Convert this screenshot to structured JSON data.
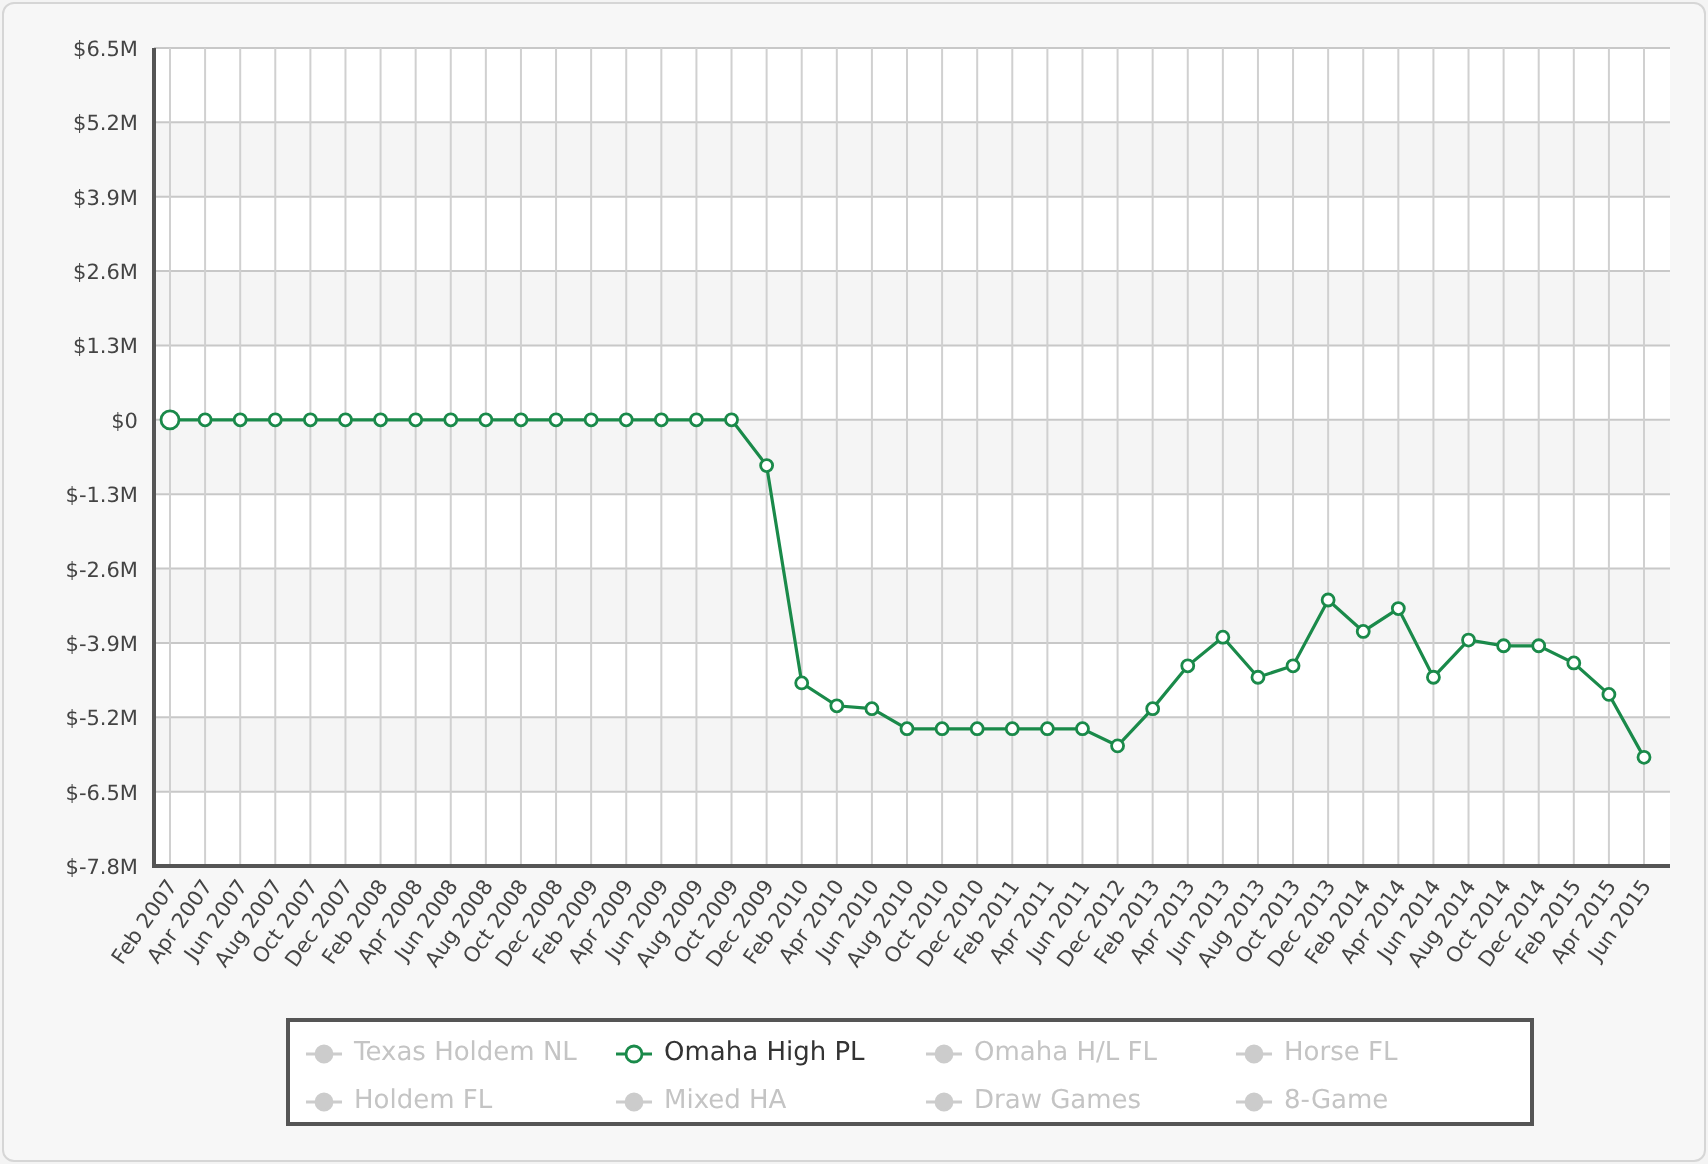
{
  "chart": {
    "chart_data": {
      "type": "line",
      "grid": true,
      "categories": [
        "Feb 2007",
        "Apr 2007",
        "Jun 2007",
        "Aug 2007",
        "Oct 2007",
        "Dec 2007",
        "Feb 2008",
        "Apr 2008",
        "Jun 2008",
        "Aug 2008",
        "Oct 2008",
        "Dec 2008",
        "Feb 2009",
        "Apr 2009",
        "Jun 2009",
        "Aug 2009",
        "Oct 2009",
        "Dec 2009",
        "Feb 2010",
        "Apr 2010",
        "Jun 2010",
        "Aug 2010",
        "Oct 2010",
        "Dec 2010",
        "Feb 2011",
        "Apr 2011",
        "Jun 2011",
        "Dec 2012",
        "Feb 2013",
        "Apr 2013",
        "Jun 2013",
        "Aug 2013",
        "Oct 2013",
        "Dec 2013",
        "Feb 2014",
        "Apr 2014",
        "Jun 2014",
        "Aug 2014",
        "Oct 2014",
        "Dec 2014",
        "Feb 2015",
        "Apr 2015",
        "Jun 2015"
      ],
      "series": [
        {
          "name": "Omaha High PL",
          "color": "#1a8a4a",
          "marker": "circle",
          "values": [
            0,
            0,
            0,
            0,
            0,
            0,
            0,
            0,
            0,
            0,
            0,
            0,
            0,
            0,
            0,
            0,
            0,
            -0.8,
            -4.6,
            -5.0,
            -5.05,
            -5.4,
            -5.4,
            -5.4,
            -5.4,
            -5.4,
            -5.4,
            -5.7,
            -5.05,
            -4.3,
            -3.8,
            -4.5,
            -4.3,
            -3.15,
            -3.7,
            -3.3,
            -4.5,
            -3.85,
            -3.95,
            -3.95,
            -4.25,
            -4.8,
            -5.9
          ]
        }
      ],
      "ylim": [
        -7.8,
        6.5
      ],
      "yticks": [
        {
          "value": 6.5,
          "label": "$6.5M"
        },
        {
          "value": 5.2,
          "label": "$5.2M"
        },
        {
          "value": 3.9,
          "label": "$3.9M"
        },
        {
          "value": 2.6,
          "label": "$2.6M"
        },
        {
          "value": 1.3,
          "label": "$1.3M"
        },
        {
          "value": 0,
          "label": "$0"
        },
        {
          "value": -1.3,
          "label": "$-1.3M"
        },
        {
          "value": -2.6,
          "label": "$-2.6M"
        },
        {
          "value": -3.9,
          "label": "$-3.9M"
        },
        {
          "value": -5.2,
          "label": "$-5.2M"
        },
        {
          "value": -6.5,
          "label": "$-6.5M"
        },
        {
          "value": -7.8,
          "label": "$-7.8M"
        }
      ]
    }
  },
  "legend": [
    {
      "label": "Texas Holdem NL",
      "visible": false
    },
    {
      "kind": "series",
      "visible": true
    },
    {
      "label": "Omaha H/L FL",
      "visible": false
    },
    {
      "label": "Horse FL",
      "visible": false
    },
    {
      "label": "Holdem FL",
      "visible": false
    },
    {
      "label": "Mixed HA",
      "visible": false
    },
    {
      "label": "Draw Games",
      "visible": false
    },
    {
      "label": "8-Game",
      "visible": false
    }
  ]
}
